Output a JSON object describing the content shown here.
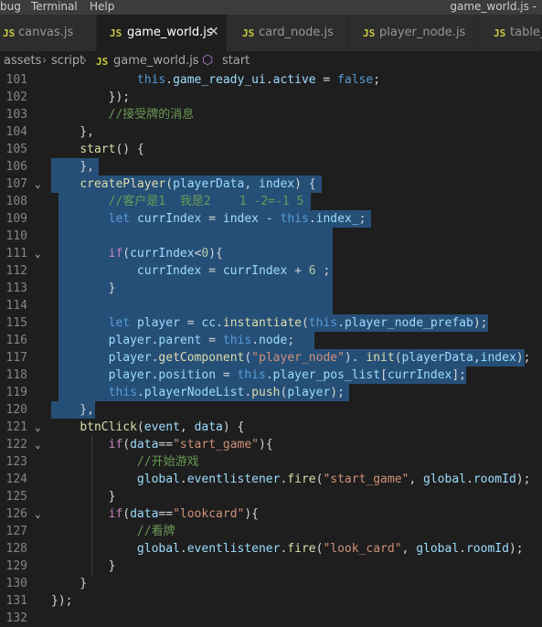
{
  "menubar": {
    "items": [
      "bug",
      "Terminal",
      "Help"
    ],
    "window_title": "game_world.js -"
  },
  "tabs": [
    {
      "icon": "JS",
      "label": "canvas.js",
      "active": false
    },
    {
      "icon": "JS",
      "label": "game_world.js",
      "active": true,
      "close": "✕"
    },
    {
      "icon": "JS",
      "label": "card_node.js",
      "active": false
    },
    {
      "icon": "JS",
      "label": "player_node.js",
      "active": false
    },
    {
      "icon": "JS",
      "label": "table_l",
      "active": false
    }
  ],
  "breadcrumb": {
    "parts": [
      "assets",
      "script",
      "game_world.js",
      "start"
    ],
    "separator": "›",
    "js_icon": "JS"
  },
  "editor": {
    "lines": [
      {
        "n": "101",
        "fold": "",
        "tokens": [
          [
            "pn",
            "            "
          ],
          [
            "kw",
            "this"
          ],
          [
            "pn",
            "."
          ],
          [
            "var",
            "game_ready_ui"
          ],
          [
            "pn",
            "."
          ],
          [
            "var",
            "active"
          ],
          [
            "pn",
            " = "
          ],
          [
            "kw",
            "false"
          ],
          [
            "pn",
            ";"
          ]
        ]
      },
      {
        "n": "102",
        "fold": "",
        "tokens": [
          [
            "pn",
            "        });"
          ]
        ]
      },
      {
        "n": "103",
        "fold": "",
        "tokens": [
          [
            "cm",
            "        //接受牌的消息"
          ]
        ]
      },
      {
        "n": "104",
        "fold": "",
        "tokens": [
          [
            "pn",
            "    },"
          ]
        ]
      },
      {
        "n": "105",
        "fold": "",
        "tokens": [
          [
            "pn",
            "    "
          ],
          [
            "fn",
            "start"
          ],
          [
            "pn",
            "() {"
          ]
        ]
      },
      {
        "n": "106",
        "fold": "",
        "tokens": [
          [
            "pn",
            "    },"
          ]
        ]
      },
      {
        "n": "107",
        "fold": "⌄",
        "tokens": [
          [
            "pn",
            "    "
          ],
          [
            "fn",
            "createPlayer"
          ],
          [
            "pn",
            "("
          ],
          [
            "var",
            "playerData"
          ],
          [
            "pn",
            ", "
          ],
          [
            "var",
            "index"
          ],
          [
            "pn",
            ") {"
          ]
        ]
      },
      {
        "n": "108",
        "fold": "",
        "tokens": [
          [
            "cm",
            "        //客户是1  我是2    1 -2=-1 5"
          ]
        ]
      },
      {
        "n": "109",
        "fold": "",
        "tokens": [
          [
            "pn",
            "        "
          ],
          [
            "kw",
            "let"
          ],
          [
            "pn",
            " "
          ],
          [
            "var",
            "currIndex"
          ],
          [
            "pn",
            " = "
          ],
          [
            "var",
            "index"
          ],
          [
            "pn",
            " - "
          ],
          [
            "kw",
            "this"
          ],
          [
            "pn",
            "."
          ],
          [
            "var",
            "index_"
          ],
          [
            "pn",
            ";"
          ]
        ]
      },
      {
        "n": "110",
        "fold": "",
        "tokens": []
      },
      {
        "n": "111",
        "fold": "⌄",
        "tokens": [
          [
            "pn",
            "        "
          ],
          [
            "kw2",
            "if"
          ],
          [
            "pn",
            "("
          ],
          [
            "var",
            "currIndex"
          ],
          [
            "pn",
            "<"
          ],
          [
            "num",
            "0"
          ],
          [
            "pn",
            "){"
          ]
        ]
      },
      {
        "n": "112",
        "fold": "",
        "tokens": [
          [
            "pn",
            "            "
          ],
          [
            "var",
            "currIndex"
          ],
          [
            "pn",
            " = "
          ],
          [
            "var",
            "currIndex"
          ],
          [
            "pn",
            " + "
          ],
          [
            "num",
            "6"
          ],
          [
            "pn",
            " ;"
          ]
        ]
      },
      {
        "n": "113",
        "fold": "",
        "tokens": [
          [
            "pn",
            "        }"
          ]
        ]
      },
      {
        "n": "114",
        "fold": "",
        "tokens": []
      },
      {
        "n": "115",
        "fold": "",
        "tokens": [
          [
            "pn",
            "        "
          ],
          [
            "kw",
            "let"
          ],
          [
            "pn",
            " "
          ],
          [
            "var",
            "player"
          ],
          [
            "pn",
            " = "
          ],
          [
            "var",
            "cc"
          ],
          [
            "pn",
            "."
          ],
          [
            "fn",
            "instantiate"
          ],
          [
            "pn",
            "("
          ],
          [
            "kw",
            "this"
          ],
          [
            "pn",
            "."
          ],
          [
            "var",
            "player_node_prefab"
          ],
          [
            "pn",
            ");"
          ]
        ]
      },
      {
        "n": "116",
        "fold": "",
        "tokens": [
          [
            "pn",
            "        "
          ],
          [
            "var",
            "player"
          ],
          [
            "pn",
            "."
          ],
          [
            "var",
            "parent"
          ],
          [
            "pn",
            " = "
          ],
          [
            "kw",
            "this"
          ],
          [
            "pn",
            "."
          ],
          [
            "var",
            "node"
          ],
          [
            "pn",
            ";"
          ]
        ]
      },
      {
        "n": "117",
        "fold": "",
        "tokens": [
          [
            "pn",
            "        "
          ],
          [
            "var",
            "player"
          ],
          [
            "pn",
            "."
          ],
          [
            "fn",
            "getComponent"
          ],
          [
            "pn",
            "("
          ],
          [
            "str",
            "\"player_node\""
          ],
          [
            "pn",
            "). "
          ],
          [
            "fn",
            "init"
          ],
          [
            "pn",
            "("
          ],
          [
            "var",
            "playerData"
          ],
          [
            "pn",
            ","
          ],
          [
            "var",
            "index"
          ],
          [
            "pn",
            ");"
          ]
        ]
      },
      {
        "n": "118",
        "fold": "",
        "tokens": [
          [
            "pn",
            "        "
          ],
          [
            "var",
            "player"
          ],
          [
            "pn",
            "."
          ],
          [
            "var",
            "position"
          ],
          [
            "pn",
            " = "
          ],
          [
            "kw",
            "this"
          ],
          [
            "pn",
            "."
          ],
          [
            "var",
            "player_pos_list"
          ],
          [
            "pn",
            "["
          ],
          [
            "var",
            "currIndex"
          ],
          [
            "pn",
            "];"
          ]
        ]
      },
      {
        "n": "119",
        "fold": "",
        "tokens": [
          [
            "pn",
            "        "
          ],
          [
            "kw",
            "this"
          ],
          [
            "pn",
            "."
          ],
          [
            "var",
            "playerNodeList"
          ],
          [
            "pn",
            "."
          ],
          [
            "fn",
            "push"
          ],
          [
            "pn",
            "("
          ],
          [
            "var",
            "player"
          ],
          [
            "pn",
            ");"
          ]
        ]
      },
      {
        "n": "120",
        "fold": "",
        "tokens": [
          [
            "pn",
            "    },"
          ]
        ]
      },
      {
        "n": "121",
        "fold": "⌄",
        "tokens": [
          [
            "pn",
            "    "
          ],
          [
            "fn",
            "btnClick"
          ],
          [
            "pn",
            "("
          ],
          [
            "var",
            "event"
          ],
          [
            "pn",
            ", "
          ],
          [
            "var",
            "data"
          ],
          [
            "pn",
            ") {"
          ]
        ]
      },
      {
        "n": "122",
        "fold": "⌄",
        "tokens": [
          [
            "pn",
            "        "
          ],
          [
            "kw2",
            "if"
          ],
          [
            "pn",
            "("
          ],
          [
            "var",
            "data"
          ],
          [
            "pn",
            "=="
          ],
          [
            "str",
            "\"start_game\""
          ],
          [
            "pn",
            "){"
          ]
        ]
      },
      {
        "n": "123",
        "fold": "",
        "tokens": [
          [
            "cm",
            "            //开始游戏"
          ]
        ]
      },
      {
        "n": "124",
        "fold": "",
        "tokens": [
          [
            "pn",
            "            "
          ],
          [
            "var",
            "global"
          ],
          [
            "pn",
            "."
          ],
          [
            "var",
            "eventlistener"
          ],
          [
            "pn",
            "."
          ],
          [
            "fn",
            "fire"
          ],
          [
            "pn",
            "("
          ],
          [
            "str",
            "\"start_game\""
          ],
          [
            "pn",
            ", "
          ],
          [
            "var",
            "global"
          ],
          [
            "pn",
            "."
          ],
          [
            "var",
            "roomId"
          ],
          [
            "pn",
            ");"
          ]
        ]
      },
      {
        "n": "125",
        "fold": "",
        "tokens": [
          [
            "pn",
            "        }"
          ]
        ]
      },
      {
        "n": "126",
        "fold": "⌄",
        "tokens": [
          [
            "pn",
            "        "
          ],
          [
            "kw2",
            "if"
          ],
          [
            "pn",
            "("
          ],
          [
            "var",
            "data"
          ],
          [
            "pn",
            "=="
          ],
          [
            "str",
            "\"lookcard\""
          ],
          [
            "pn",
            "){"
          ]
        ]
      },
      {
        "n": "127",
        "fold": "",
        "tokens": [
          [
            "cm",
            "            //看牌"
          ]
        ]
      },
      {
        "n": "128",
        "fold": "",
        "tokens": [
          [
            "pn",
            "            "
          ],
          [
            "var",
            "global"
          ],
          [
            "pn",
            "."
          ],
          [
            "var",
            "eventlistener"
          ],
          [
            "pn",
            "."
          ],
          [
            "fn",
            "fire"
          ],
          [
            "pn",
            "("
          ],
          [
            "str",
            "\"look_card\""
          ],
          [
            "pn",
            ", "
          ],
          [
            "var",
            "global"
          ],
          [
            "pn",
            "."
          ],
          [
            "var",
            "roomId"
          ],
          [
            "pn",
            ");"
          ]
        ]
      },
      {
        "n": "129",
        "fold": "",
        "tokens": [
          [
            "pn",
            "        }"
          ]
        ]
      },
      {
        "n": "130",
        "fold": "",
        "tokens": [
          [
            "pn",
            "    }"
          ]
        ]
      },
      {
        "n": "131",
        "fold": "",
        "tokens": [
          [
            "pn",
            "});"
          ]
        ]
      },
      {
        "n": "132",
        "fold": "",
        "tokens": []
      }
    ]
  }
}
